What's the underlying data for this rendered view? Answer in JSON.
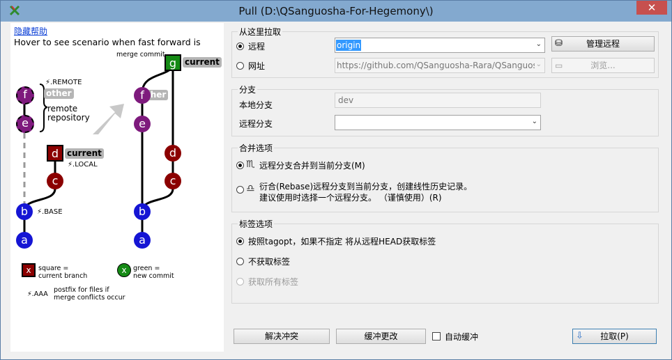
{
  "window": {
    "title": "Pull (D:\\QSanguosha-For-Hegemony\\)",
    "close": "✕"
  },
  "help": {
    "hide_link": "隐藏帮助",
    "hover_text": "Hover to see scenario when fast forward is",
    "merge_commit": "merge commit",
    "remote_label": "⚡.REMOTE",
    "other_tag": "other",
    "remote_repo": "remote\nrepository",
    "current_tag": "current",
    "local_label": "⚡.LOCAL",
    "base_label": "⚡.BASE",
    "other_tag2": "ther",
    "current_tag2": "current",
    "nodes_left": [
      "f",
      "e",
      "d",
      "c",
      "b",
      "a"
    ],
    "nodes_right": [
      "g",
      "f",
      "e",
      "d",
      "c",
      "b",
      "a"
    ],
    "legend_square_x": "x",
    "legend_square_text": "square =\ncurrent branch",
    "legend_green_x": "x",
    "legend_green_text": "green =\nnew commit",
    "legend_aaa": "⚡.AAA",
    "legend_aaa_text": "postfix for files if\nmerge conflicts occur"
  },
  "pull_from": {
    "group_title": "从这里拉取",
    "remote_label": "远程",
    "remote_value": "origin",
    "manage_remote_button": "管理远程",
    "url_label": "网址",
    "url_value": "https://github.com/QSanguosha-Rara/QSanguos",
    "browse_button": "浏览..."
  },
  "branch": {
    "group_title": "分支",
    "local_label": "本地分支",
    "local_value": "dev",
    "remote_label": "远程分支",
    "remote_value": ""
  },
  "merge": {
    "group_title": "合并选项",
    "option1": "远程分支合并到当前分支(M)",
    "option2_line1": "衍合(Rebase)远程分支到当前分支，创建线性历史记录。",
    "option2_line2": "建议使用时选择一个远程分支。 （谨慎使用）(R)"
  },
  "tags": {
    "group_title": "标签选项",
    "option1": "按照tagopt，如果不指定 将从远程HEAD获取标签",
    "option2": "不获取标签",
    "option3": "获取所有标签"
  },
  "bottom": {
    "resolve_button": "解决冲突",
    "stash_button": "缓冲更改",
    "auto_stash_label": "自动缓冲",
    "pull_button": "拉取(P)"
  },
  "colors": {
    "purple": "#7e1a7d",
    "darkred": "#8b0000",
    "blue": "#1515d4",
    "green": "#158a15",
    "titlebar": "#83a9cf",
    "selection": "#3399ff"
  }
}
